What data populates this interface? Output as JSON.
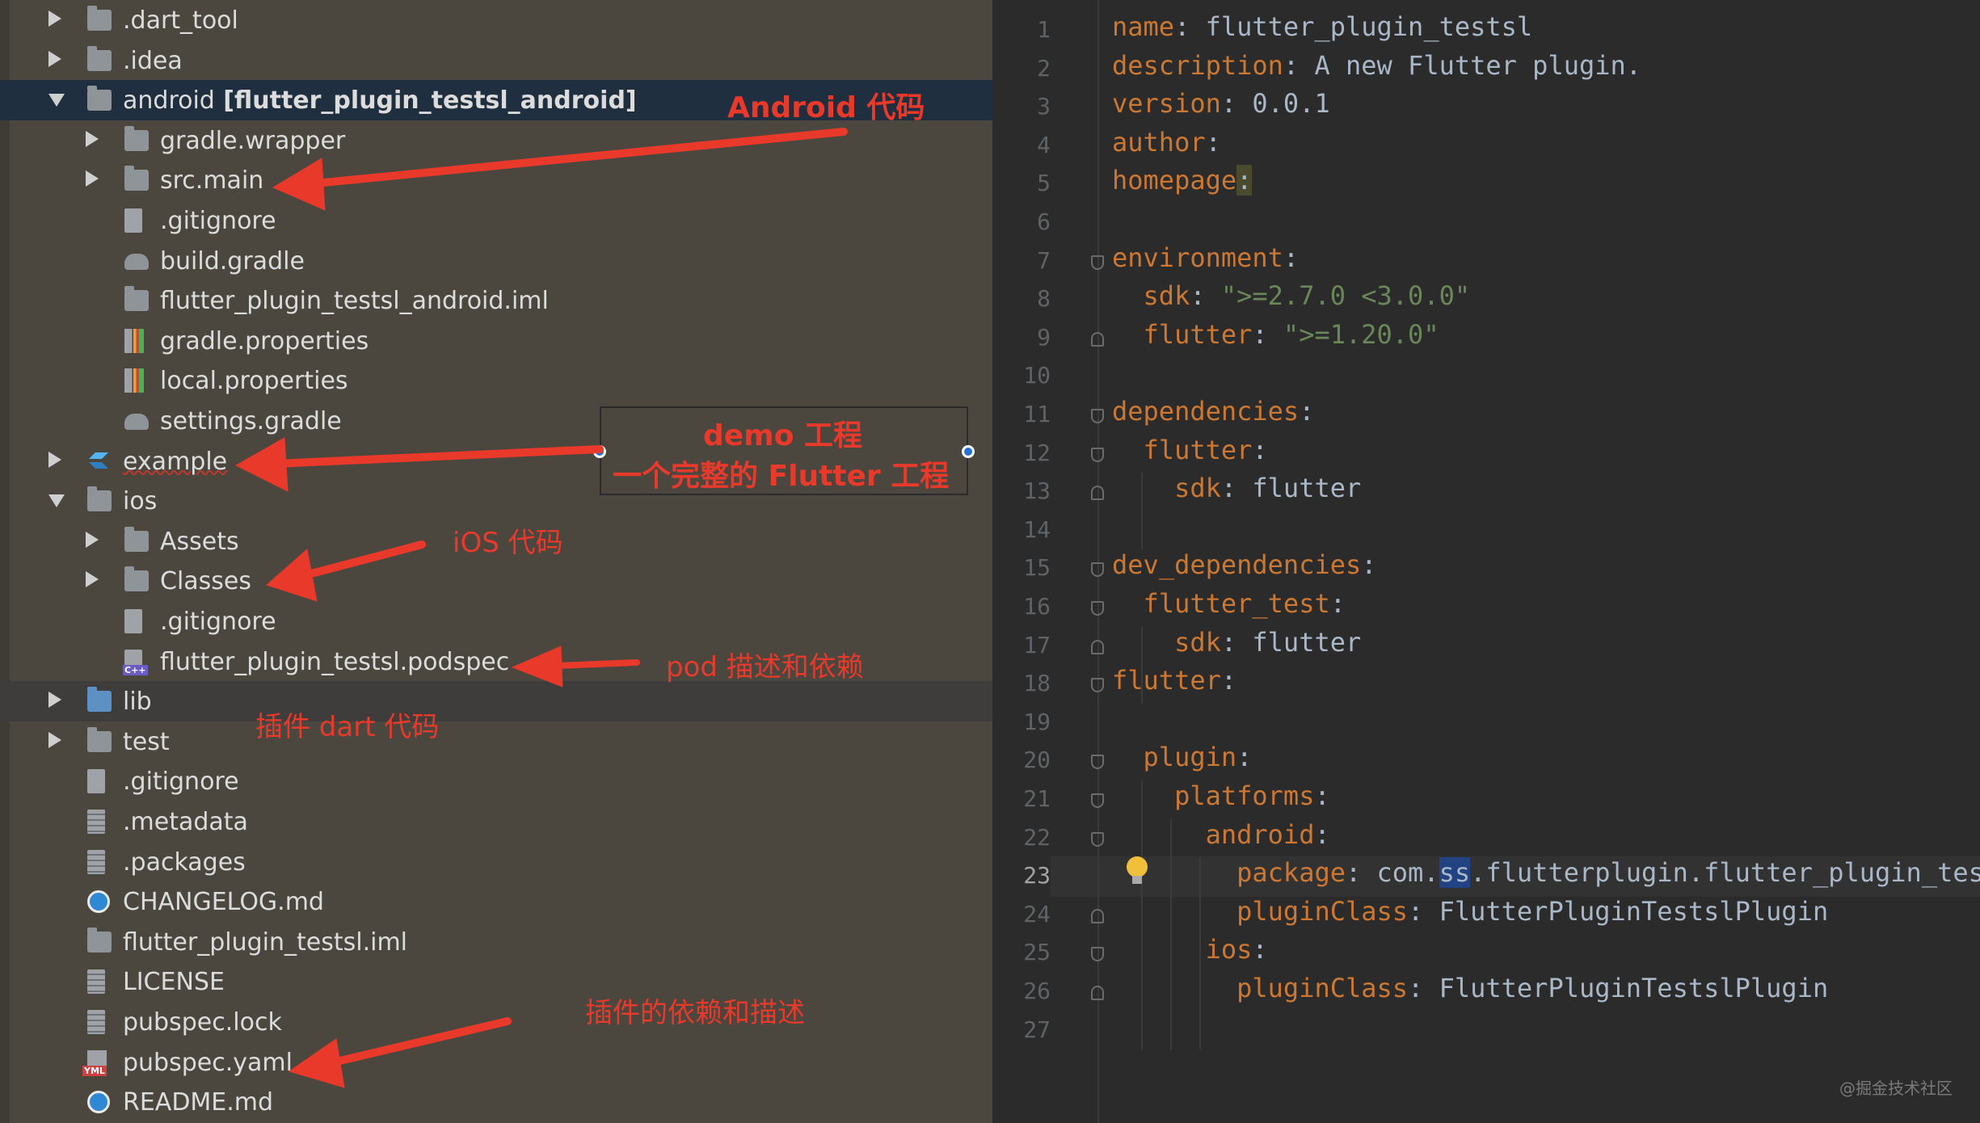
{
  "tree": [
    {
      "label": ".dart_tool",
      "indent": 0,
      "toggle": "collapsed",
      "icon": "folder-icon"
    },
    {
      "label": ".idea",
      "indent": 0,
      "toggle": "collapsed",
      "icon": "settings-folder-icon"
    },
    {
      "label": "android",
      "extra": " [flutter_plugin_testsl_android]",
      "indent": 0,
      "toggle": "expanded",
      "icon": "module-folder-icon",
      "state": "selected"
    },
    {
      "label": "gradle.wrapper",
      "indent": 1,
      "toggle": "collapsed",
      "icon": "folder-icon"
    },
    {
      "label": "src.main",
      "indent": 1,
      "toggle": "collapsed",
      "icon": "folder-icon"
    },
    {
      "label": ".gitignore",
      "indent": 1,
      "toggle": "none",
      "icon": "gitignore-file-icon"
    },
    {
      "label": "build.gradle",
      "indent": 1,
      "toggle": "none",
      "icon": "gradle-file-icon"
    },
    {
      "label": "flutter_plugin_testsl_android.iml",
      "indent": 1,
      "toggle": "none",
      "icon": "iml-file-icon"
    },
    {
      "label": "gradle.properties",
      "indent": 1,
      "toggle": "none",
      "icon": "properties-file-icon"
    },
    {
      "label": "local.properties",
      "indent": 1,
      "toggle": "none",
      "icon": "properties-file-icon"
    },
    {
      "label": "settings.gradle",
      "indent": 1,
      "toggle": "none",
      "icon": "gradle-file-icon"
    },
    {
      "label": "example",
      "indent": 0,
      "toggle": "collapsed",
      "icon": "flutter-icon",
      "squiggle": true
    },
    {
      "label": "ios",
      "indent": 0,
      "toggle": "expanded",
      "icon": "folder-icon"
    },
    {
      "label": "Assets",
      "indent": 1,
      "toggle": "collapsed",
      "icon": "folder-icon"
    },
    {
      "label": "Classes",
      "indent": 1,
      "toggle": "collapsed",
      "icon": "folder-icon"
    },
    {
      "label": ".gitignore",
      "indent": 1,
      "toggle": "none",
      "icon": "gitignore-file-icon"
    },
    {
      "label": "flutter_plugin_testsl.podspec",
      "indent": 1,
      "toggle": "none",
      "icon": "podspec-file-icon"
    },
    {
      "label": "lib",
      "indent": 0,
      "toggle": "collapsed",
      "icon": "source-folder-icon",
      "state": "highlight"
    },
    {
      "label": "test",
      "indent": 0,
      "toggle": "collapsed",
      "icon": "test-folder-icon"
    },
    {
      "label": ".gitignore",
      "indent": 0,
      "toggle": "none",
      "icon": "gitignore-file-icon"
    },
    {
      "label": ".metadata",
      "indent": 0,
      "toggle": "none",
      "icon": "text-file-icon"
    },
    {
      "label": ".packages",
      "indent": 0,
      "toggle": "none",
      "icon": "text-file-icon"
    },
    {
      "label": "CHANGELOG.md",
      "indent": 0,
      "toggle": "none",
      "icon": "markdown-icon"
    },
    {
      "label": "flutter_plugin_testsl.iml",
      "indent": 0,
      "toggle": "none",
      "icon": "iml-file-icon"
    },
    {
      "label": "LICENSE",
      "indent": 0,
      "toggle": "none",
      "icon": "text-file-icon"
    },
    {
      "label": "pubspec.lock",
      "indent": 0,
      "toggle": "none",
      "icon": "text-file-icon"
    },
    {
      "label": "pubspec.yaml",
      "indent": 0,
      "toggle": "none",
      "icon": "yaml-file-icon"
    },
    {
      "label": "README.md",
      "indent": 0,
      "toggle": "none",
      "icon": "markdown-icon"
    }
  ],
  "annotations": {
    "android_code": "Android 代码",
    "demo_line1": "demo 工程",
    "demo_line2": "一个完整的 Flutter 工程",
    "ios_code": "iOS 代码",
    "pod_desc": "pod 描述和依赖",
    "plugin_dart": "插件 dart 代码",
    "plugin_deps": "插件的依赖和描述"
  },
  "editor": {
    "current_line": 23,
    "lines": [
      [
        {
          "t": "name",
          "c": "k"
        },
        {
          "t": ": flutter_plugin_testsl"
        }
      ],
      [
        {
          "t": "description",
          "c": "k"
        },
        {
          "t": ": A new Flutter plugin."
        }
      ],
      [
        {
          "t": "version",
          "c": "k"
        },
        {
          "t": ": 0.0.1"
        }
      ],
      [
        {
          "t": "author",
          "c": "k"
        },
        {
          "t": ":"
        }
      ],
      [
        {
          "t": "homepage",
          "c": "k"
        },
        {
          "t": ":",
          "c": "hl"
        }
      ],
      [],
      [
        {
          "t": "environment",
          "c": "k"
        },
        {
          "t": ":"
        }
      ],
      [
        {
          "t": "  "
        },
        {
          "t": "sdk",
          "c": "k"
        },
        {
          "t": ": "
        },
        {
          "t": "\">=2.7.0 <3.0.0\"",
          "c": "s"
        }
      ],
      [
        {
          "t": "  "
        },
        {
          "t": "flutter",
          "c": "k"
        },
        {
          "t": ": "
        },
        {
          "t": "\">=1.20.0\"",
          "c": "s"
        }
      ],
      [],
      [
        {
          "t": "dependencies",
          "c": "k"
        },
        {
          "t": ":"
        }
      ],
      [
        {
          "t": "  "
        },
        {
          "t": "flutter",
          "c": "k"
        },
        {
          "t": ":"
        }
      ],
      [
        {
          "t": "    "
        },
        {
          "t": "sdk",
          "c": "k"
        },
        {
          "t": ": flutter"
        }
      ],
      [],
      [
        {
          "t": "dev_dependencies",
          "c": "k"
        },
        {
          "t": ":"
        }
      ],
      [
        {
          "t": "  "
        },
        {
          "t": "flutter_test",
          "c": "k"
        },
        {
          "t": ":"
        }
      ],
      [
        {
          "t": "    "
        },
        {
          "t": "sdk",
          "c": "k"
        },
        {
          "t": ": flutter"
        }
      ],
      [
        {
          "t": "flutter",
          "c": "k"
        },
        {
          "t": ":"
        }
      ],
      [],
      [
        {
          "t": "  "
        },
        {
          "t": "plugin",
          "c": "k"
        },
        {
          "t": ":"
        }
      ],
      [
        {
          "t": "    "
        },
        {
          "t": "platforms",
          "c": "k"
        },
        {
          "t": ":"
        }
      ],
      [
        {
          "t": "      "
        },
        {
          "t": "android",
          "c": "k"
        },
        {
          "t": ":"
        }
      ],
      [
        {
          "t": "        "
        },
        {
          "t": "package",
          "c": "k"
        },
        {
          "t": ": com."
        },
        {
          "t": "ss",
          "c": "sel"
        },
        {
          "t": ".flutterplugin.flutter_plugin_testsl"
        }
      ],
      [
        {
          "t": "        "
        },
        {
          "t": "pluginClass",
          "c": "k"
        },
        {
          "t": ": FlutterPluginTestslPlugin"
        }
      ],
      [
        {
          "t": "      "
        },
        {
          "t": "ios",
          "c": "k"
        },
        {
          "t": ":"
        }
      ],
      [
        {
          "t": "        "
        },
        {
          "t": "pluginClass",
          "c": "k"
        },
        {
          "t": ": FlutterPluginTestslPlugin"
        }
      ],
      []
    ]
  },
  "watermark": "@掘金技术社区",
  "colors": {
    "annotation": "#e8392b",
    "keyword": "#cc7832",
    "string": "#6a8759",
    "text": "#a9b7c6"
  }
}
